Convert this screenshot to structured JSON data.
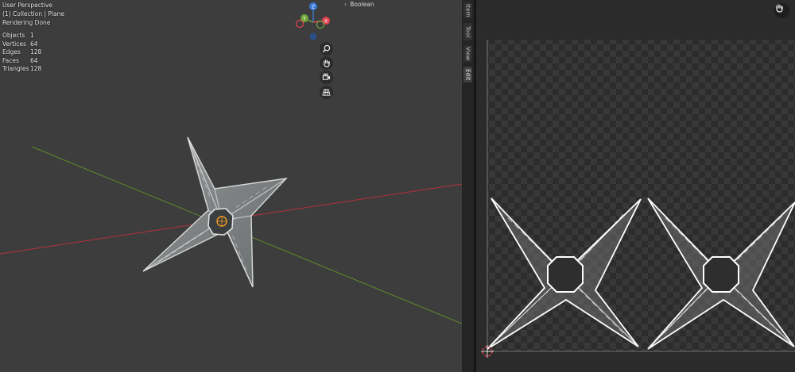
{
  "viewport": {
    "perspective_label": "User Perspective",
    "collection_label": "(1) Collection | Plane",
    "render_status": "Rendering Done",
    "stats": [
      {
        "label": "Objects",
        "value": "1"
      },
      {
        "label": "Vertices",
        "value": "64"
      },
      {
        "label": "Edges",
        "value": "128"
      },
      {
        "label": "Faces",
        "value": "64"
      },
      {
        "label": "Triangles",
        "value": "128"
      }
    ],
    "gizmo": {
      "z": "Z",
      "y": "Y",
      "x": "X"
    },
    "modifier_header": "Boolean"
  },
  "sidebar_tabs": [
    {
      "label": "Item"
    },
    {
      "label": "Tool"
    },
    {
      "label": "View"
    },
    {
      "label": "Edit"
    }
  ],
  "icons": {
    "zoom": "zoom-icon",
    "pan": "hand-icon",
    "camera": "camera-icon",
    "ortho": "grid-icon",
    "uv_pan": "hand-icon"
  },
  "colors": {
    "axis_x": "#b4323c",
    "axis_y": "#5e8a2a",
    "gizmo_x": "#e24452",
    "gizmo_y": "#6fa83a",
    "gizmo_z": "#3a7ad6",
    "origin": "#f29c1c"
  }
}
